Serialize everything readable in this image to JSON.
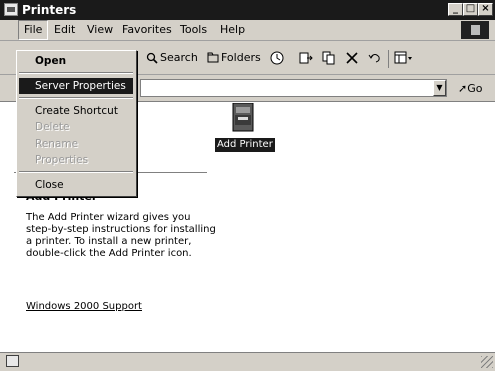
{
  "window": {
    "title": "Printers"
  },
  "menubar": {
    "items": [
      "File",
      "Edit",
      "View",
      "Favorites",
      "Tools",
      "Help"
    ]
  },
  "toolbar": {
    "search_label": "Search",
    "folders_label": "Folders"
  },
  "address": {
    "value": "",
    "go_label": "Go"
  },
  "content": {
    "printer_label": "Add Printer",
    "heading": "Add Printer",
    "description": "The Add Printer wizard gives you step-by-step instructions for installing a printer. To install a new printer, double-click the Add Printer icon.",
    "support_link": "Windows 2000 Support"
  },
  "file_menu": {
    "open": "Open",
    "server_properties": "Server Properties",
    "create_shortcut": "Create Shortcut",
    "delete": "Delete",
    "rename": "Rename",
    "properties": "Properties",
    "close": "Close"
  }
}
